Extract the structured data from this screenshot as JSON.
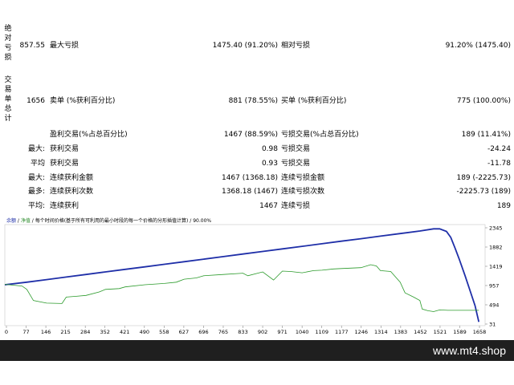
{
  "report": {
    "section_absolute_label": "绝对亏损",
    "section_trades_label": "交易单总计",
    "absolute_loss": "857.55",
    "max_loss_label": "最大亏损",
    "max_loss_value": "1475.40 (91.20%)",
    "relative_loss_label": "相对亏损",
    "relative_loss_value": "91.20% (1475.40)",
    "total_trades": "1656",
    "short_label": "卖单 (%获利百分比)",
    "short_value": "881 (78.55%)",
    "long_label": "买单 (%获利百分比)",
    "long_value": "775 (100.00%)",
    "profit_trades_label": "盈利交易(%占总百分比)",
    "profit_trades_value": "1467 (88.59%)",
    "loss_trades_label": "亏损交易(%占总百分比)",
    "loss_trades_value": "189 (11.41%)",
    "rows": [
      {
        "prefix": "最大:",
        "l_label": "获利交易",
        "l_value": "0.98",
        "r_label": "亏损交易",
        "r_value": "-24.24"
      },
      {
        "prefix": "平均",
        "l_label": "获利交易",
        "l_value": "0.93",
        "r_label": "亏损交易",
        "r_value": "-11.78"
      },
      {
        "prefix": "最大:",
        "l_label": "连续获利金额",
        "l_value": "1467 (1368.18)",
        "r_label": "连续亏损金额",
        "r_value": "189 (-2225.73)"
      },
      {
        "prefix": "最多:",
        "l_label": "连续获利次数",
        "l_value": "1368.18 (1467)",
        "r_label": "连续亏损次数",
        "r_value": "-2225.73 (189)"
      },
      {
        "prefix": "平均:",
        "l_label": "连续获利",
        "l_value": "1467",
        "r_label": "连续亏损",
        "r_value": "189"
      }
    ]
  },
  "chart_legend": {
    "balance": "余额",
    "sep1": " / ",
    "equity": "净值",
    "rest": " / 每个时间价格(基于所有可利用的最小时段的每一个价格的分形插值计算) / 90.00%"
  },
  "colors": {
    "balance": "#1f2fa8",
    "equity": "#2a9a2a",
    "footer_bg": "#1f1f1f"
  },
  "chart_data": {
    "type": "line",
    "x_ticks": [
      "0",
      "77",
      "146",
      "215",
      "284",
      "352",
      "421",
      "490",
      "558",
      "627",
      "696",
      "765",
      "833",
      "902",
      "971",
      "1040",
      "1109",
      "1177",
      "1246",
      "1314",
      "1383",
      "1452",
      "1521",
      "1589",
      "1658"
    ],
    "y_ticks": [
      "2345",
      "1882",
      "1419",
      "957",
      "494",
      "31"
    ],
    "series": [
      {
        "name": "余额",
        "values": [
          [
            0,
            990
          ],
          [
            77,
            1050
          ],
          [
            146,
            1110
          ],
          [
            215,
            1170
          ],
          [
            284,
            1230
          ],
          [
            352,
            1290
          ],
          [
            421,
            1350
          ],
          [
            490,
            1410
          ],
          [
            558,
            1470
          ],
          [
            627,
            1530
          ],
          [
            696,
            1590
          ],
          [
            765,
            1650
          ],
          [
            833,
            1710
          ],
          [
            902,
            1770
          ],
          [
            971,
            1830
          ],
          [
            1040,
            1890
          ],
          [
            1109,
            1950
          ],
          [
            1177,
            2010
          ],
          [
            1246,
            2070
          ],
          [
            1314,
            2130
          ],
          [
            1383,
            2190
          ],
          [
            1452,
            2250
          ],
          [
            1500,
            2300
          ],
          [
            1521,
            2300
          ],
          [
            1545,
            2240
          ],
          [
            1560,
            2100
          ],
          [
            1575,
            1850
          ],
          [
            1589,
            1600
          ],
          [
            1610,
            1200
          ],
          [
            1630,
            800
          ],
          [
            1645,
            500
          ],
          [
            1658,
            120
          ]
        ]
      },
      {
        "name": "净值",
        "values": [
          [
            0,
            1000
          ],
          [
            60,
            960
          ],
          [
            77,
            880
          ],
          [
            100,
            620
          ],
          [
            146,
            560
          ],
          [
            200,
            550
          ],
          [
            215,
            700
          ],
          [
            250,
            720
          ],
          [
            284,
            740
          ],
          [
            330,
            820
          ],
          [
            352,
            880
          ],
          [
            400,
            900
          ],
          [
            421,
            940
          ],
          [
            490,
            990
          ],
          [
            558,
            1020
          ],
          [
            600,
            1050
          ],
          [
            627,
            1120
          ],
          [
            670,
            1150
          ],
          [
            696,
            1200
          ],
          [
            765,
            1230
          ],
          [
            833,
            1260
          ],
          [
            850,
            1200
          ],
          [
            902,
            1290
          ],
          [
            940,
            1100
          ],
          [
            971,
            1310
          ],
          [
            1000,
            1300
          ],
          [
            1040,
            1270
          ],
          [
            1080,
            1320
          ],
          [
            1109,
            1330
          ],
          [
            1150,
            1360
          ],
          [
            1177,
            1370
          ],
          [
            1246,
            1390
          ],
          [
            1280,
            1460
          ],
          [
            1300,
            1430
          ],
          [
            1314,
            1320
          ],
          [
            1350,
            1300
          ],
          [
            1383,
            1050
          ],
          [
            1400,
            800
          ],
          [
            1430,
            700
          ],
          [
            1452,
            620
          ],
          [
            1460,
            420
          ],
          [
            1480,
            380
          ],
          [
            1500,
            360
          ],
          [
            1521,
            400
          ],
          [
            1550,
            390
          ],
          [
            1589,
            390
          ],
          [
            1620,
            390
          ],
          [
            1658,
            390
          ]
        ]
      }
    ],
    "ylim": [
      31,
      2400
    ],
    "xlim": [
      0,
      1680
    ]
  },
  "footer": {
    "brand": "www.mt4.shop"
  }
}
